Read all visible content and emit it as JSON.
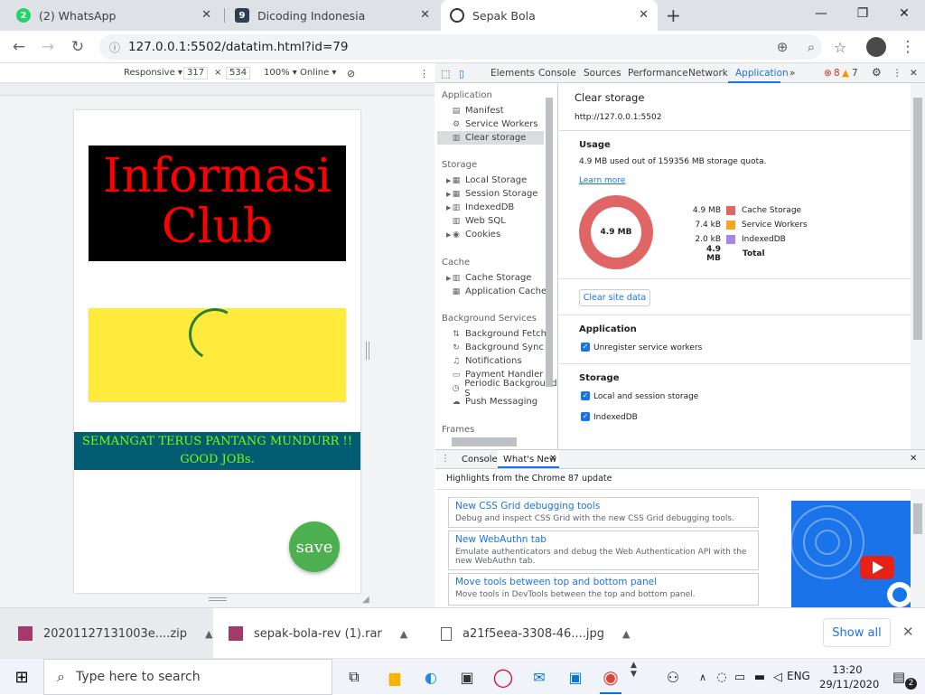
{
  "tabs": [
    {
      "title": "(2) WhatsApp",
      "badge": "2"
    },
    {
      "title": "Dicoding Indonesia",
      "badge": "9"
    },
    {
      "title": "Sepak Bola",
      "badge": ""
    }
  ],
  "new_tab": "+",
  "address": {
    "url": "127.0.0.1:5502/datatim.html?id=79"
  },
  "device_toolbar": {
    "mode": "Responsive ▾",
    "width": "317",
    "times": "×",
    "height": "534",
    "zoom": "100% ▾",
    "network": "Online ▾"
  },
  "page": {
    "title_line1": "Informasi",
    "title_line2": "Club",
    "banner_line1": "SEMANGAT TERUS PANTANG MUNDURR !!",
    "banner_line2": "GOOD JOBs.",
    "save_label": "save"
  },
  "devtools": {
    "tabs": [
      "Elements",
      "Console",
      "Sources",
      "Performance",
      "Network",
      "Application",
      "»"
    ],
    "selected_tab": "Application",
    "errors": "8",
    "warnings": "7",
    "sidebar": {
      "application_header": "Application",
      "application_items": [
        "Manifest",
        "Service Workers",
        "Clear storage"
      ],
      "storage_header": "Storage",
      "storage_items": [
        "Local Storage",
        "Session Storage",
        "IndexedDB",
        "Web SQL",
        "Cookies"
      ],
      "cache_header": "Cache",
      "cache_items": [
        "Cache Storage",
        "Application Cache"
      ],
      "bg_header": "Background Services",
      "bg_items": [
        "Background Fetch",
        "Background Sync",
        "Notifications",
        "Payment Handler",
        "Periodic Background S",
        "Push Messaging"
      ],
      "frames_header": "Frames"
    },
    "panel": {
      "title": "Clear storage",
      "origin": "http://127.0.0.1:5502",
      "usage_header": "Usage",
      "usage_text": "4.9 MB used out of 159356 MB storage quota.",
      "learn_more": "Learn more",
      "donut_label": "4.9 MB",
      "legend": [
        {
          "value": "4.9 MB",
          "label": "Cache Storage",
          "color": "#e06666"
        },
        {
          "value": "7.4 kB",
          "label": "Service Workers",
          "color": "#f4a622"
        },
        {
          "value": "2.0 kB",
          "label": "IndexedDB",
          "color": "#a686e8"
        }
      ],
      "total_value": "4.9 MB",
      "total_label": "Total",
      "clear_button": "Clear site data",
      "app_header": "Application",
      "app_checkbox": "Unregister service workers",
      "storage_header": "Storage",
      "storage_cb1": "Local and session storage",
      "storage_cb2": "IndexedDB"
    },
    "drawer": {
      "tabs": [
        "Console",
        "What's New"
      ],
      "highlights": "Highlights from the Chrome 87 update",
      "cards": [
        {
          "title": "New CSS Grid debugging tools",
          "desc": "Debug and inspect CSS Grid with the new CSS Grid debugging tools."
        },
        {
          "title": "New WebAuthn tab",
          "desc": "Emulate authenticators and debug the Web Authentication API with the new WebAuthn tab."
        },
        {
          "title": "Move tools between top and bottom panel",
          "desc": "Move tools in DevTools between the top and bottom panel."
        }
      ]
    }
  },
  "downloads": {
    "items": [
      "20201127131003e....zip",
      "sepak-bola-rev (1).rar",
      "a21f5eea-3308-46....jpg"
    ],
    "show_all": "Show all"
  },
  "taskbar": {
    "search_placeholder": "Type here to search",
    "language": "ENG",
    "time": "13:20",
    "date": "29/11/2020",
    "notification_count": "2"
  },
  "colors": {
    "hero_bg": "#000000",
    "hero_text": "#ff0000",
    "card_bg": "#ffeb3b",
    "banner_bg": "#035d72",
    "banner_text": "#76ff03",
    "save_bg": "#4caf50"
  }
}
